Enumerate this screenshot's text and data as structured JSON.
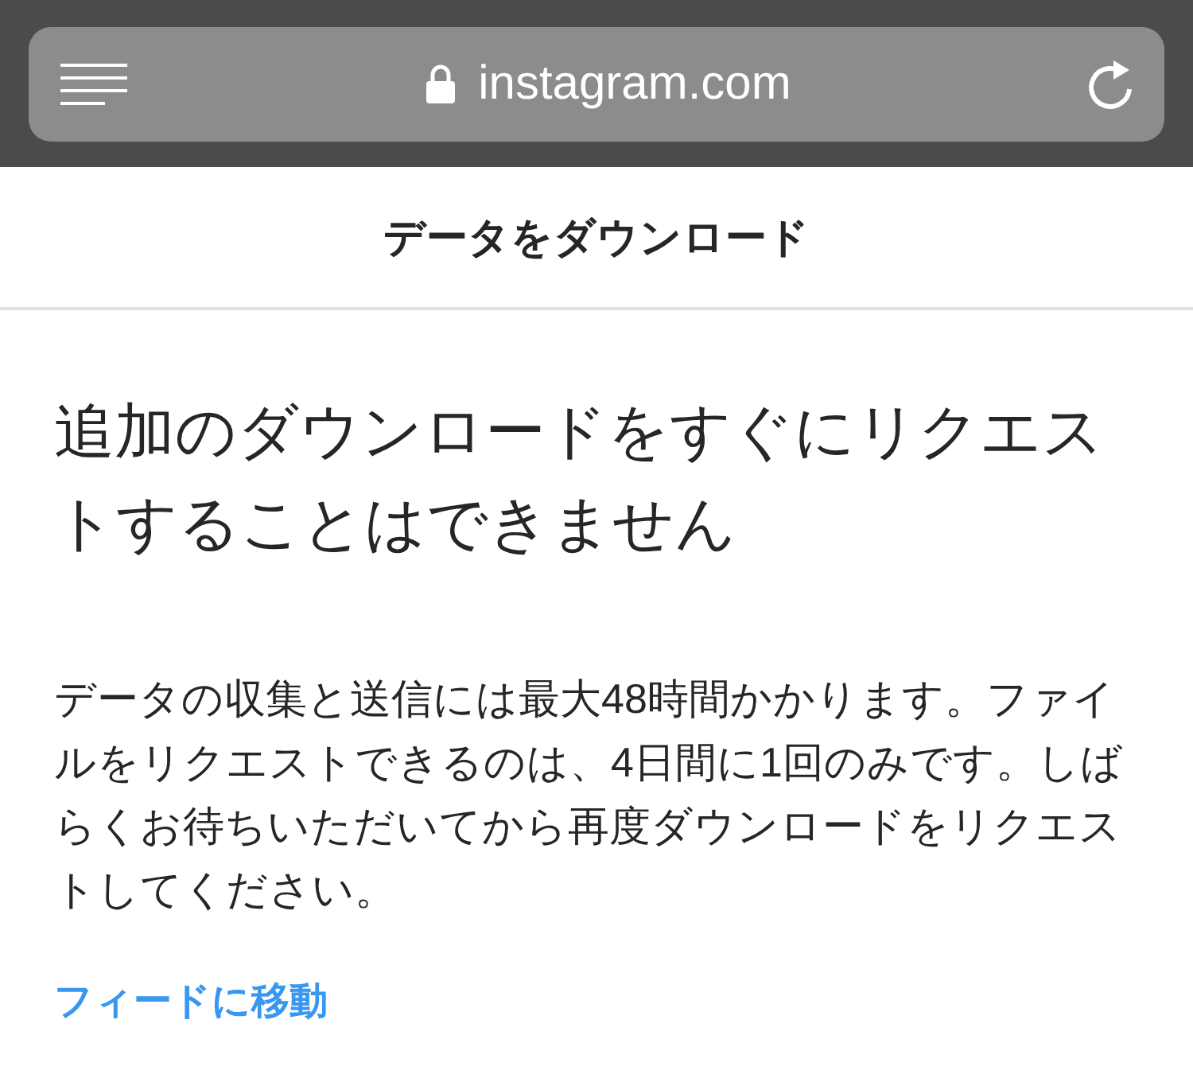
{
  "browser_bar": {
    "url": "instagram.com"
  },
  "header": {
    "title": "データをダウンロード"
  },
  "content": {
    "heading": "追加のダウンロードをすぐにリクエストすることはできません",
    "body": "データの収集と送信には最大48時間かかります。ファイルをリクエストできるのは、4日間に1回のみです。しばらくお待ちいただいてから再度ダウンロードをリクエストしてください。",
    "link": "フィードに移動"
  }
}
